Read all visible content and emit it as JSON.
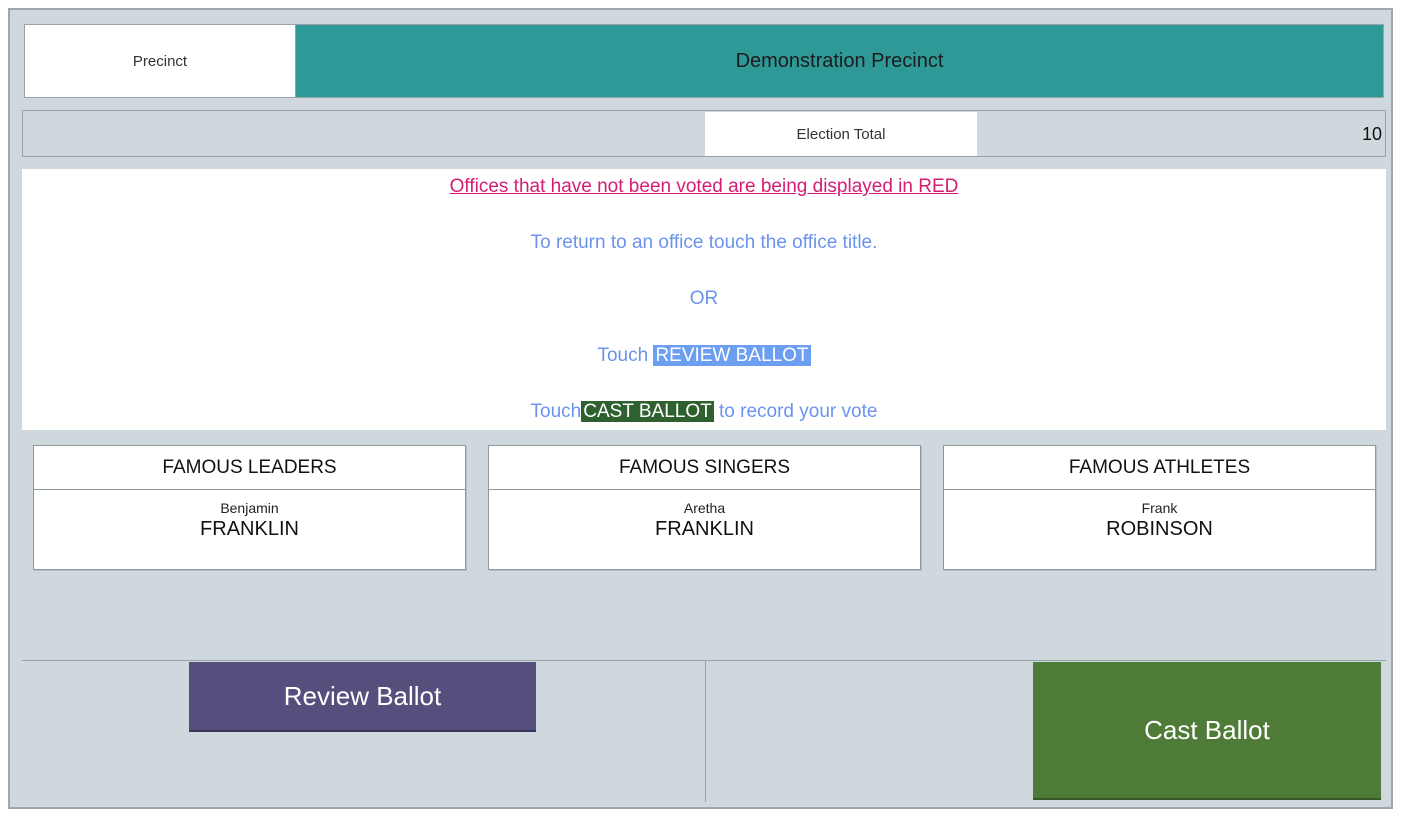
{
  "precinct": {
    "label": "Precinct",
    "name": "Demonstration Precinct"
  },
  "election_total": {
    "label": "Election Total",
    "value": "10"
  },
  "instructions": {
    "warning": "Offices that have not been voted are being displayed in RED",
    "return_line": "To return to an office touch the office title.",
    "or": "OR",
    "touch_prefix": "Touch",
    "review_highlight": "REVIEW BALLOT",
    "cast_prefix": "Touch",
    "cast_highlight": "CAST BALLOT",
    "cast_suffix": "to record your vote"
  },
  "offices": [
    {
      "title": "FAMOUS LEADERS",
      "first_name": "Benjamin",
      "last_name": "FRANKLIN"
    },
    {
      "title": "FAMOUS SINGERS",
      "first_name": "Aretha",
      "last_name": "FRANKLIN"
    },
    {
      "title": "FAMOUS ATHLETES",
      "first_name": "Frank",
      "last_name": "ROBINSON"
    }
  ],
  "buttons": {
    "review": "Review Ballot",
    "cast": "Cast Ballot"
  },
  "colors": {
    "precinct_header": "#2e9996",
    "warning_text": "#d51e73",
    "instruction_text": "#6b93ee",
    "review_button": "#554f7d",
    "cast_button": "#4f7b39"
  }
}
